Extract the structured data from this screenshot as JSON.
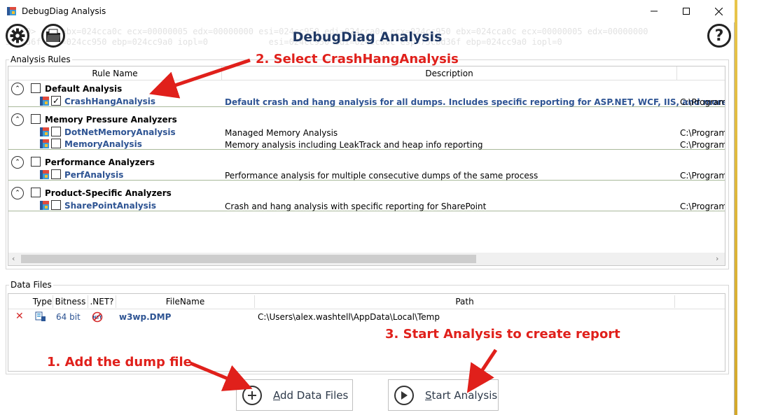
{
  "window": {
    "title": "DebugDiag Analysis",
    "minimize_glyph": "—",
    "maximize_glyph": "☐",
    "close_glyph": "✕"
  },
  "header": {
    "heading": "DebugDiag Analysis",
    "register_line_1": "0:000> r   ebx=024cca0c ecx=00000005 edx=00000000 esi=024cc950 edi=024cca0c ecx=024cc950 ebx=024cca0c ecx=00000005 edx=00000000",
    "register_line_2": "5bcd36f esp=024cc950 ebp=024cc9a0 iopl=0            esi=024cc950 edi=024cca0c esp=75cbd36f ebp=024cc9a0 iopl=0",
    "help_glyph": "?",
    "icons": {
      "settings": "gear-icon",
      "open": "open-folder-icon",
      "help": "help-icon"
    }
  },
  "analysis_rules": {
    "group_title": "Analysis Rules",
    "columns": [
      "Rule Name",
      "Description",
      ""
    ],
    "groups": [
      {
        "label": "Default Analysis",
        "expander_glyph": "⌃",
        "rules": [
          {
            "name": "CrashHangAnalysis",
            "checked": true,
            "check_glyph": "✓",
            "description": "Default crash and hang analysis for all dumps.  Includes specific reporting for ASP.NET, WCF, IIS, and more",
            "path": "C:\\Program"
          }
        ]
      },
      {
        "label": "Memory Pressure Analyzers",
        "expander_glyph": "⌃",
        "rules": [
          {
            "name": "DotNetMemoryAnalysis",
            "checked": false,
            "check_glyph": "",
            "description": "Managed Memory Analysis",
            "path": "C:\\Program"
          },
          {
            "name": "MemoryAnalysis",
            "checked": false,
            "check_glyph": "",
            "description": "Memory analysis including LeakTrack and heap info reporting",
            "path": "C:\\Program"
          }
        ]
      },
      {
        "label": "Performance Analyzers",
        "expander_glyph": "⌃",
        "rules": [
          {
            "name": "PerfAnalysis",
            "checked": false,
            "check_glyph": "",
            "description": "Performance analysis for multiple consecutive dumps of the same process",
            "path": "C:\\Program"
          }
        ]
      },
      {
        "label": "Product-Specific Analyzers",
        "expander_glyph": "⌃",
        "rules": [
          {
            "name": "SharePointAnalysis",
            "checked": false,
            "check_glyph": "",
            "description": "Crash and hang analysis with specific reporting for SharePoint",
            "path": "C:\\Program"
          }
        ]
      }
    ],
    "scroll_left_glyph": "‹",
    "scroll_right_glyph": "›"
  },
  "data_files": {
    "group_title": "Data Files",
    "columns": [
      "Type",
      "Bitness",
      ".NET?",
      "FileName",
      "Path"
    ],
    "rows": [
      {
        "remove_glyph": "✕",
        "bitness": "64 bit",
        "file_name": "w3wp.DMP",
        "path": "C:\\Users\\alex.washtell\\AppData\\Local\\Temp"
      }
    ]
  },
  "buttons": {
    "add_files": {
      "accel": "A",
      "rest": "dd Data Files",
      "glyph": "+"
    },
    "start_analysis": {
      "accel": "S",
      "rest": "tart Analysis",
      "glyph": "▶"
    }
  },
  "annotations": {
    "step1": "1. Add the dump file",
    "step2": "2. Select CrashHangAnalysis",
    "step3": "3. Start Analysis to  create report"
  },
  "colors": {
    "heading": "#1f3864",
    "rule_link": "#2e5493",
    "annotation": "#e0201b",
    "remove_x": "#d42a2a"
  }
}
